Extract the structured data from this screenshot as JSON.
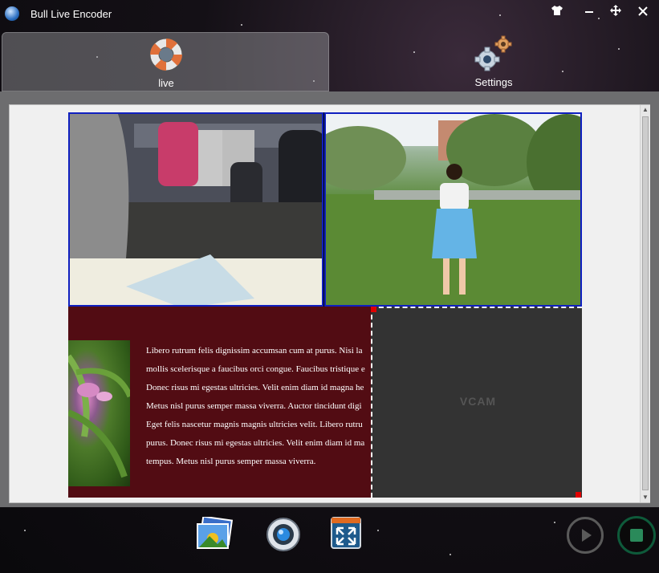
{
  "window": {
    "title": "Bull Live Encoder",
    "controls": [
      "skin-icon",
      "minimize-icon",
      "maximize-icon",
      "close-icon"
    ]
  },
  "tabs": [
    {
      "label": "live",
      "icon": "lifebuoy-icon",
      "active": true
    },
    {
      "label": "Settings",
      "icon": "gears-icon",
      "active": false
    }
  ],
  "preview": {
    "sources": [
      {
        "type": "camera",
        "description": "webcam"
      },
      {
        "type": "image",
        "description": "photo"
      },
      {
        "type": "text"
      },
      {
        "type": "vcam",
        "label": "VCAM"
      }
    ],
    "text_lines": [
      "Libero rutrum felis dignissim accumsan cum at purus. Nisi la",
      "mollis scelerisque a faucibus orci congue. Faucibus tristique e",
      "Donec risus mi egestas ultricies. Velit enim diam id magna he",
      "Metus nisl purus semper massa viverra. Auctor tincidunt digi",
      "Eget felis nascetur magnis magnis ultricies velit. Libero rutru",
      "purus. Donec risus mi egestas ultricies. Velit enim diam id ma",
      "tempus. Metus nisl purus semper massa viverra."
    ]
  },
  "toolbar": {
    "buttons": [
      "add-image-icon",
      "add-camera-icon",
      "fullscreen-icon"
    ],
    "play_state": "disabled",
    "record_state": "active"
  },
  "colors": {
    "selection_border": "#1020c0",
    "text_panel_bg": "#520c13",
    "handle": "#e00000"
  }
}
